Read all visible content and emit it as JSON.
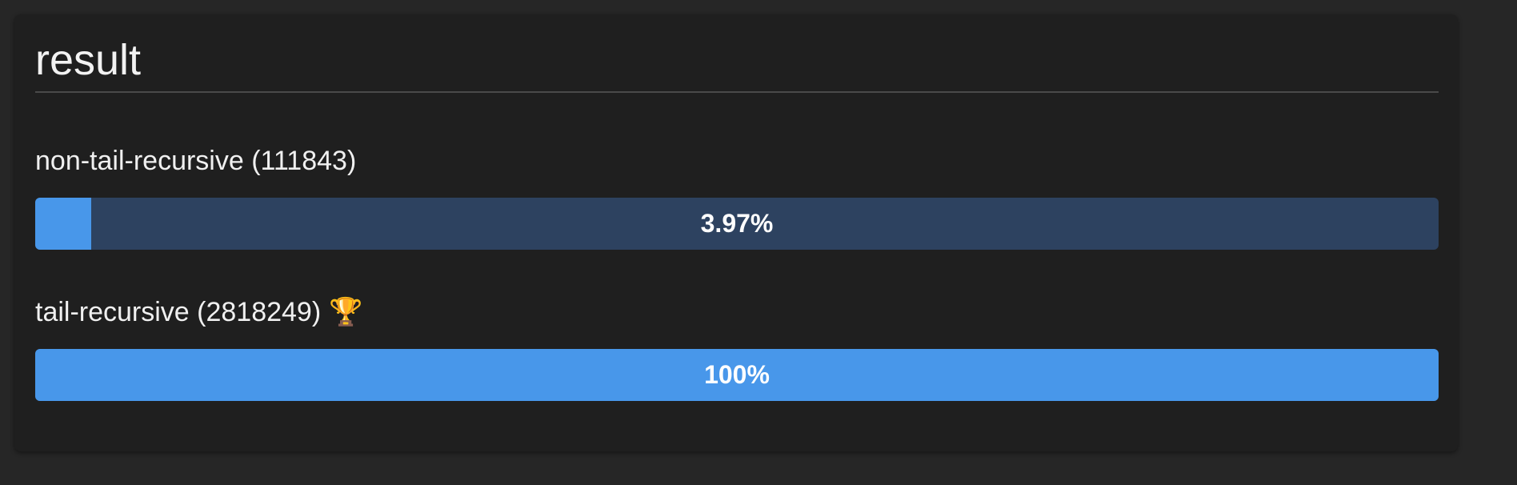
{
  "card": {
    "title": "result"
  },
  "results": [
    {
      "label": "non-tail-recursive (111843)",
      "percent_text": "3.97%",
      "fill_fraction": 0.0397,
      "winner": false
    },
    {
      "label": "tail-recursive (2818249)",
      "percent_text": "100%",
      "fill_fraction": 1.0,
      "winner": true,
      "badge_icon": "trophy-icon"
    }
  ],
  "colors": {
    "background": "#262626",
    "card": "#1f1f1f",
    "bar_track": "#2d4260",
    "bar_fill": "#4897ea",
    "text": "#ffffff"
  }
}
